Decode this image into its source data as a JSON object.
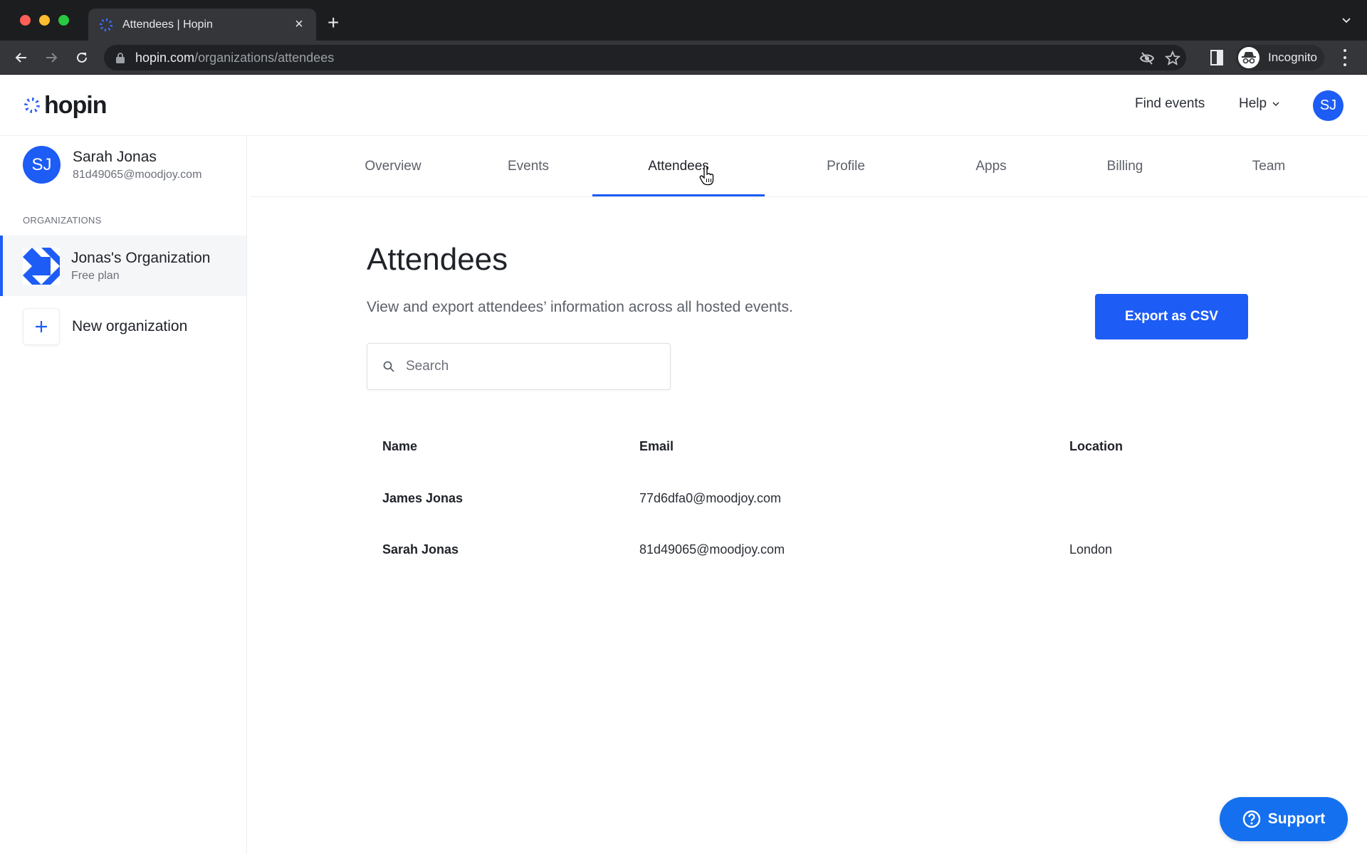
{
  "browser": {
    "tab_title": "Attendees | Hopin",
    "url_host": "hopin.com",
    "url_path": "/organizations/attendees",
    "profile_label": "Incognito"
  },
  "header": {
    "logo_text": "hopin",
    "find_events": "Find events",
    "help": "Help",
    "avatar_initials": "SJ"
  },
  "sidebar": {
    "user": {
      "initials": "SJ",
      "name": "Sarah Jonas",
      "email": "81d49065@moodjoy.com"
    },
    "section_label": "ORGANIZATIONS",
    "organizations": [
      {
        "name": "Jonas's Organization",
        "plan": "Free plan",
        "selected": true
      }
    ],
    "new_org_label": "New organization"
  },
  "tabs": [
    {
      "label": "Overview",
      "active": false
    },
    {
      "label": "Events",
      "active": false
    },
    {
      "label": "Attendees",
      "active": true
    },
    {
      "label": "Profile",
      "active": false
    },
    {
      "label": "Apps",
      "active": false
    },
    {
      "label": "Billing",
      "active": false
    },
    {
      "label": "Team",
      "active": false
    }
  ],
  "main": {
    "title": "Attendees",
    "description": "View and export attendees’ information across all hosted events.",
    "export_label": "Export as CSV",
    "search_placeholder": "Search",
    "search_value": ""
  },
  "table": {
    "columns": [
      "Name",
      "Email",
      "Location"
    ],
    "rows": [
      {
        "name": "James Jonas",
        "email": "77d6dfa0@moodjoy.com",
        "location": ""
      },
      {
        "name": "Sarah Jonas",
        "email": "81d49065@moodjoy.com",
        "location": "London"
      }
    ]
  },
  "support": {
    "label": "Support"
  },
  "colors": {
    "brand": "#1d5cf5",
    "support": "#1570ef"
  }
}
